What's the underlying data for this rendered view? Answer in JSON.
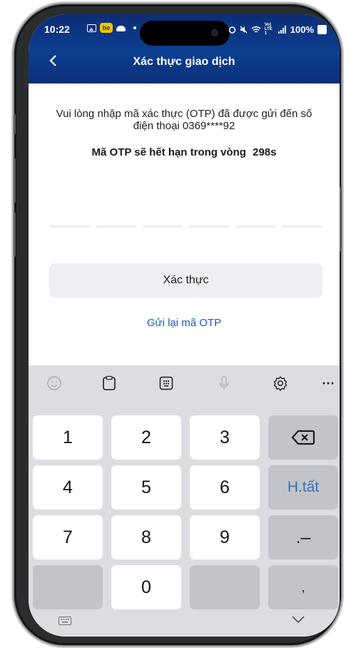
{
  "status_bar": {
    "time": "10:22",
    "be_badge": "be",
    "battery": "100%",
    "network": "Vo) LTE1"
  },
  "header": {
    "title": "Xác thực giao dịch",
    "back_icon": "chevron-left-icon"
  },
  "otp": {
    "instruction": "Vui lòng nhập mã xác thực (OTP) đã được gửi đến số điện thoại  0369****92",
    "expiry_label": "Mã OTP sẽ hết hạn trong vòng",
    "expiry_seconds": "298s",
    "digit_count": 6
  },
  "actions": {
    "verify_label": "Xác thực",
    "resend_label": "Gửi lại mã OTP"
  },
  "keyboard": {
    "toolbar_icons": [
      "emoji-icon",
      "clipboard-icon",
      "keypad-icon",
      "microphone-icon",
      "settings-icon",
      "more-icon"
    ],
    "more_label": "⋯",
    "keys": {
      "k1": "1",
      "k2": "2",
      "k3": "3",
      "k4": "4",
      "k5": "5",
      "k6": "6",
      "k7": "7",
      "k8": "8",
      "k9": "9",
      "k0": "0",
      "done": "H.tất",
      "dot_dash": ".–",
      "comma": ","
    }
  },
  "colors": {
    "header_bg": "#0d3f91",
    "link": "#1858c9",
    "done_key": "#3b6fb6",
    "keyboard_bg": "#dcdde1"
  }
}
